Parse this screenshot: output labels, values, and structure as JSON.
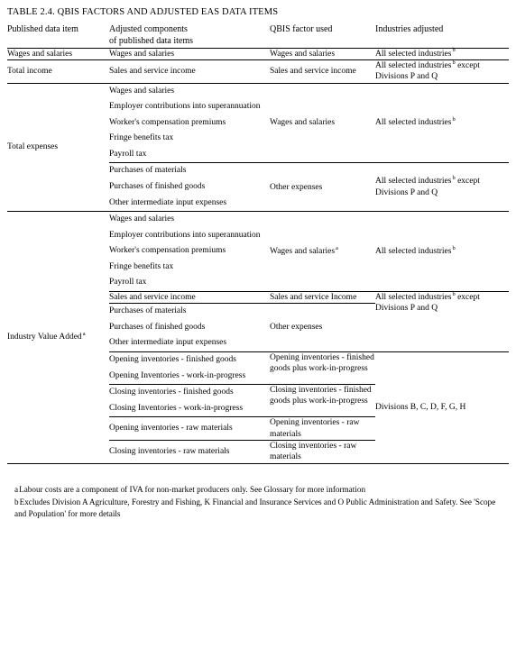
{
  "title": "TABLE 2.4. QBIS FACTORS AND ADJUSTED EAS DATA ITEMS",
  "columns": [
    {
      "label": "Published data item"
    },
    {
      "label_line1": "Adjusted components",
      "label_line2": "of published data items"
    },
    {
      "label": "QBIS factor used"
    },
    {
      "label": "Industries adjusted"
    }
  ],
  "rows": {
    "wages_and_salaries": {
      "published": "Wages and salaries",
      "components": "Wages and salaries",
      "qbis_factor": "Wages and salaries",
      "industries": "All selected industries",
      "industries_sup": "b"
    },
    "total_income": {
      "published": "Total income",
      "components": "Sales and service income",
      "qbis_factor": "Sales and service income",
      "industries_line1": "All selected industries",
      "industries_sup": "b",
      "industries_line1_tail": " except",
      "industries_line2": "Divisions P and Q"
    },
    "total_expenses": {
      "published": "Total expenses",
      "group1": {
        "components": [
          "Wages and salaries",
          "Employer contributions into superannuation",
          "Worker's compensation premiums",
          "Fringe benefits tax",
          "Payroll tax"
        ],
        "qbis_factor": "Wages and salaries",
        "industries": "All selected industries",
        "industries_sup": "b"
      },
      "group2": {
        "components": [
          "Purchases of materials",
          "Purchases of finished goods",
          "Other intermediate input expenses"
        ],
        "qbis_factor": "Other expenses",
        "industries_line1": "All selected industries",
        "industries_sup": "b",
        "industries_line1_tail": " except",
        "industries_line2": "Divisions P and Q"
      }
    },
    "industry_value_added": {
      "published": "Industry Value Added",
      "published_sup": "a",
      "group1": {
        "components": [
          "Wages and salaries",
          "Employer contributions into superannuation",
          "Worker's compensation premiums",
          "Fringe benefits tax",
          "Payroll tax"
        ],
        "qbis_factor": "Wages and salaries",
        "qbis_factor_sup": "a",
        "industries": "All selected industries",
        "industries_sup": "b"
      },
      "group2": {
        "components": [
          "Sales and service income"
        ],
        "qbis_factor": "Sales and service Income"
      },
      "group3": {
        "components": [
          "Purchases of materials",
          "Purchases of finished goods",
          "Other intermediate input expenses"
        ],
        "qbis_factor": "Other expenses",
        "industries_line1": "All selected industries",
        "industries_sup": "b",
        "industries_line1_tail": " except",
        "industries_line2": "Divisions P and Q"
      },
      "group4": {
        "components": [
          "Opening inventories - finished goods",
          "Opening Inventories - work-in-progress"
        ],
        "qbis_factor": "Opening inventories - finished goods plus work-in-progress"
      },
      "group5": {
        "components": [
          "Closing inventories - finished goods",
          "Closing Inventories - work-in-progress"
        ],
        "qbis_factor": "Closing inventories - finished goods plus work-in-progress",
        "industries": "Divisions B, C, D, F, G, H"
      },
      "group6": {
        "components": [
          "Opening inventories - raw materials"
        ],
        "qbis_factor": "Opening inventories - raw materials"
      },
      "group7": {
        "components": [
          "Closing inventories - raw materials"
        ],
        "qbis_factor": "Closing inventories - raw materials"
      }
    }
  },
  "footnotes": [
    {
      "mark": "a",
      "text": "Labour costs are a component of IVA for non-market producers only. See Glossary for more information"
    },
    {
      "mark": "b",
      "text": "Excludes Division A Agriculture, Forestry and Fishing, K Financial and Insurance Services and O Public Administration and Safety. See 'Scope and Population' for more details"
    }
  ]
}
